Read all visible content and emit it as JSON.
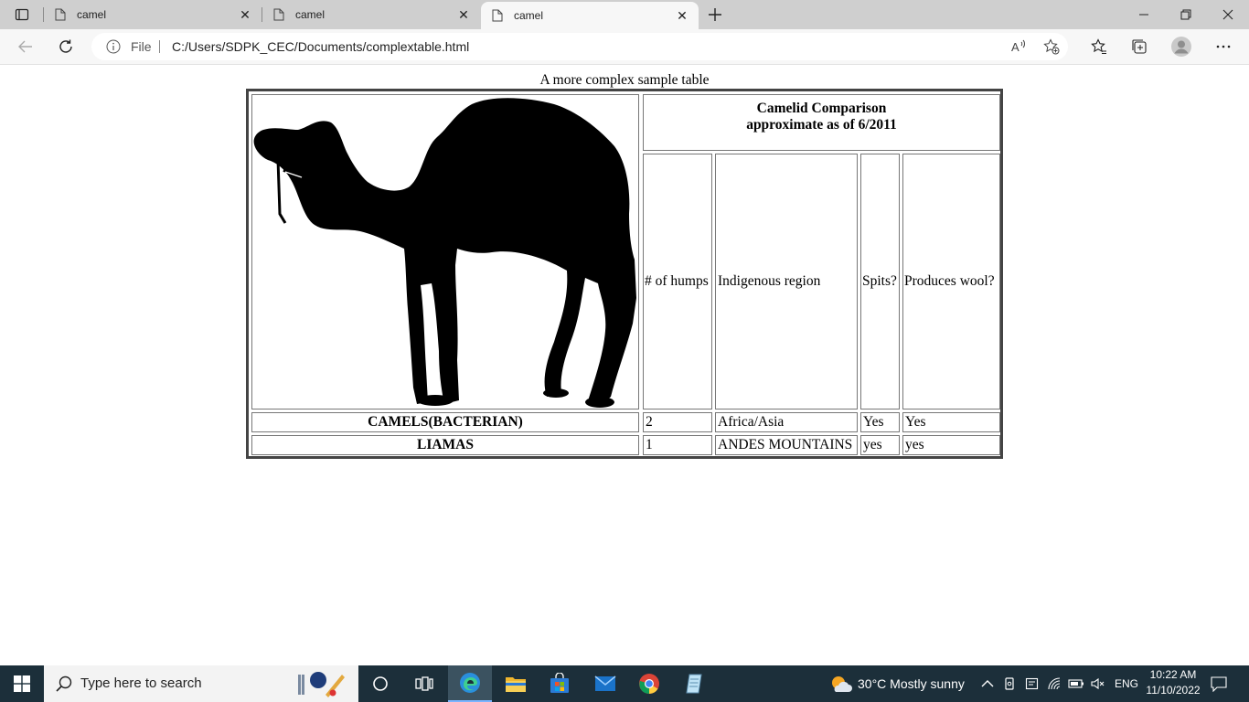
{
  "browser": {
    "tabs": [
      {
        "label": "camel",
        "active": false
      },
      {
        "label": "camel",
        "active": false
      },
      {
        "label": "camel",
        "active": true
      }
    ],
    "address": {
      "scheme_label": "File",
      "url": "C:/Users/SDPK_CEC/Documents/complextable.html"
    }
  },
  "page": {
    "caption": "A more complex sample table",
    "header_title_line1": "Camelid Comparison",
    "header_title_line2": "approximate as of 6/2011",
    "columns": [
      "# of humps",
      "Indigenous region",
      "Spits?",
      "Produces wool?"
    ],
    "rows": [
      {
        "name": "CAMELS(BACTERIAN)",
        "humps": "2",
        "region": "Africa/Asia",
        "spits": "Yes",
        "wool": "Yes"
      },
      {
        "name": "LIAMAS",
        "humps": "1",
        "region": "ANDES MOUNTAINS",
        "spits": "yes",
        "wool": "yes"
      }
    ],
    "image": {
      "subject": "camel silhouette"
    }
  },
  "taskbar": {
    "search_placeholder": "Type here to search",
    "weather": "30°C  Mostly sunny",
    "language": "ENG",
    "time": "10:22 AM",
    "date": "11/10/2022",
    "apps": [
      "task-view",
      "edge",
      "file-explorer",
      "microsoft-store",
      "mail",
      "chrome",
      "notepad"
    ]
  },
  "colors": {
    "tabstrip": "#cfcfcf",
    "active_tab": "#f7f7f7",
    "taskbar": "#1c2f3a",
    "table_border": "#444444"
  }
}
